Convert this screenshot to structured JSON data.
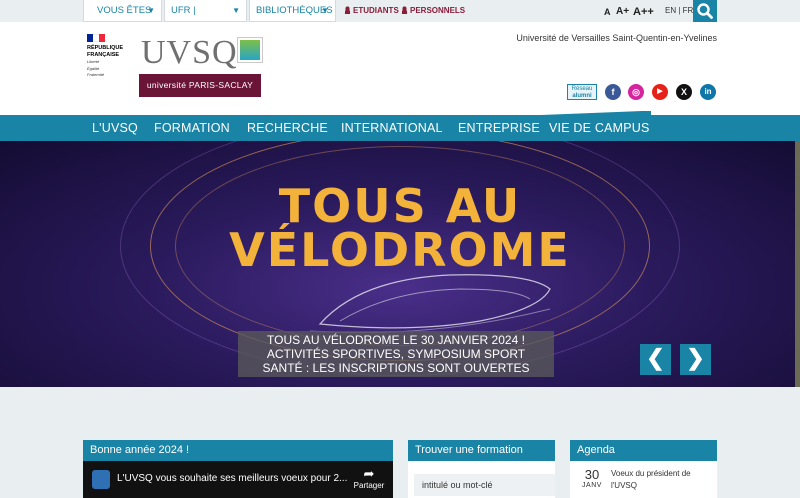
{
  "topbar": {
    "dropdowns": [
      {
        "label": "VOUS ÊTES"
      },
      {
        "label": "UFR | INSTITUTS"
      },
      {
        "label": "BIBLIOTHÈQUES"
      }
    ],
    "links": [
      "ETUDIANTS",
      "PERSONNELS"
    ],
    "font_sizes": [
      "A",
      "A+",
      "A++"
    ],
    "lang": {
      "en": "EN",
      "sep": "|",
      "fr": "FR"
    },
    "search_icon": "search-icon"
  },
  "header": {
    "republique": [
      "RÉPUBLIQUE",
      "FRANÇAISE"
    ],
    "devise": [
      "Liberté",
      "Égalité",
      "Fraternité"
    ],
    "logo_text": "UVSQ",
    "paris_saclay": "université PARIS-SACLAY",
    "tagline": "Université de Versailles Saint-Quentin-en-Yvelines",
    "alumni": [
      "Réseau",
      "alumni"
    ],
    "social": [
      {
        "name": "facebook-icon",
        "glyph": "f",
        "color": "#3b5998"
      },
      {
        "name": "instagram-icon",
        "glyph": "◎",
        "color": "#d6249f"
      },
      {
        "name": "youtube-icon",
        "glyph": "▶",
        "color": "#e62117"
      },
      {
        "name": "x-icon",
        "glyph": "X",
        "color": "#111111"
      },
      {
        "name": "linkedin-icon",
        "glyph": "in",
        "color": "#0e76a8"
      }
    ]
  },
  "nav": [
    "L'UVSQ",
    "FORMATION",
    "RECHERCHE",
    "INTERNATIONAL",
    "ENTREPRISE",
    "VIE DE CAMPUS"
  ],
  "hero": {
    "title_line1": "TOUS AU",
    "title_line2": "VÉLODROME",
    "caption": [
      "TOUS AU VÉLODROME LE 30 JANVIER 2024 !",
      "ACTIVITÉS SPORTIVES, SYMPOSIUM SPORT",
      "SANTÉ : LES INSCRIPTIONS SONT OUVERTES"
    ],
    "prev": "❮",
    "next": "❯"
  },
  "cards": {
    "news": {
      "title": "Bonne année 2024 !",
      "video_title": "L'UVSQ vous souhaite ses meilleurs voeux pour 2...",
      "share": "Partager",
      "share_icon": "share-icon"
    },
    "formation": {
      "title": "Trouver une formation",
      "placeholder": "intitulé ou mot-clé"
    },
    "agenda": {
      "title": "Agenda",
      "day": "30",
      "month": "JANV",
      "event": "Voeux du président de l'UVSQ"
    }
  },
  "colors": {
    "accent": "#1a84a6",
    "saclay": "#6a1538",
    "hero_title": "#f3b23a"
  }
}
